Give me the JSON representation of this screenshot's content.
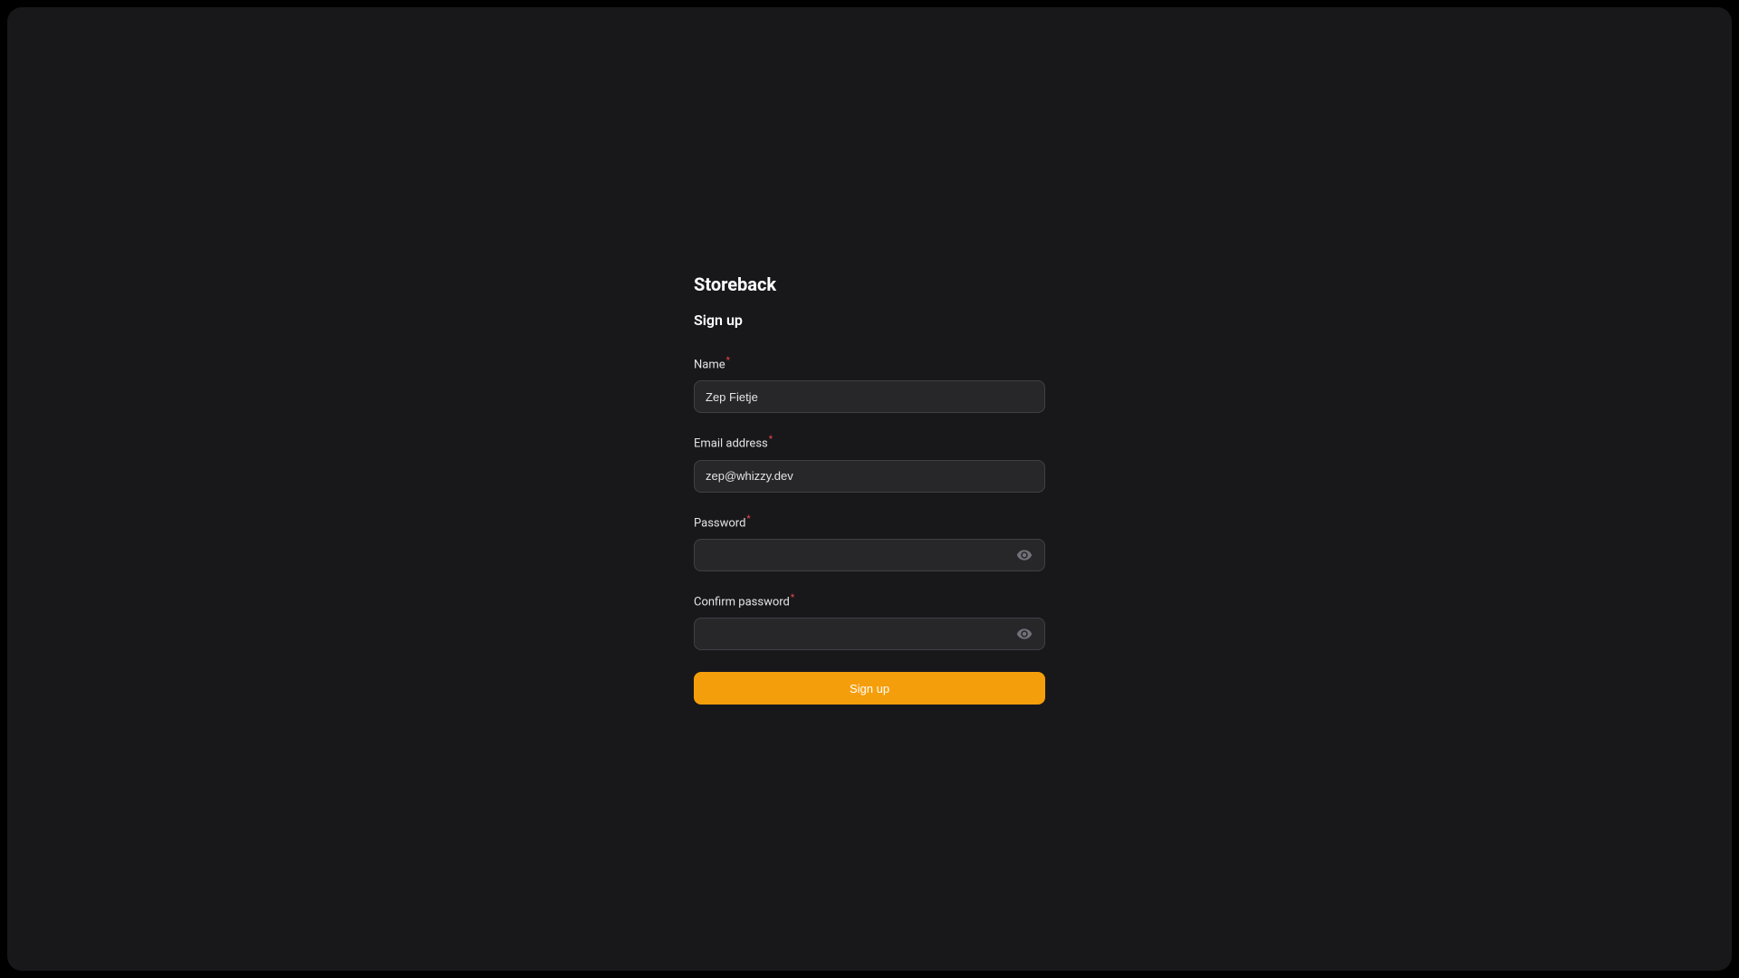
{
  "brand": "Storeback",
  "heading": "Sign up",
  "fields": {
    "name": {
      "label": "Name",
      "value": "Zep Fietje"
    },
    "email": {
      "label": "Email address",
      "value": "zep@whizzy.dev"
    },
    "password": {
      "label": "Password",
      "value": ""
    },
    "confirm_password": {
      "label": "Confirm password",
      "value": ""
    }
  },
  "required_marker": "*",
  "submit_label": "Sign up",
  "colors": {
    "background": "#18181b",
    "input_bg": "#27272a",
    "input_border": "#3f3f46",
    "accent": "#f59e0b",
    "text_primary": "#ffffff",
    "text_secondary": "#e4e4e7",
    "required": "#ef4444"
  }
}
